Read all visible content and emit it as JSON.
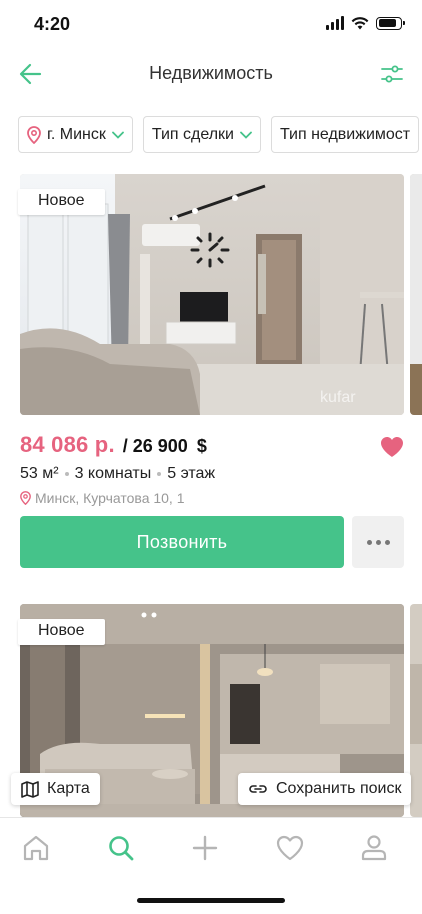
{
  "status": {
    "time": "4:20",
    "battery_level": 0.85
  },
  "header": {
    "title": "Недвижимость",
    "back_icon": "arrow-left-icon",
    "filter_icon": "sliders-icon",
    "accent": "#45c38a"
  },
  "filters": {
    "city": "г. Минск",
    "deal_type": "Тип сделки",
    "property_type": "Тип недвижимост"
  },
  "listing1": {
    "badge": "Новое",
    "price": "84 086 р.",
    "price_usd": "/ 26 900",
    "currency": "$",
    "area": "53 м²",
    "rooms": "3 комнаты",
    "floor": "5 этаж",
    "address": "Минск, Курчатова 10, 1",
    "call_label": "Позвонить",
    "favorite": true,
    "price_color": "#e6637f",
    "watermark": "kufar"
  },
  "listing2": {
    "badge": "Новое"
  },
  "floating": {
    "map_label": "Карта",
    "save_search_label": "Сохранить поиск"
  },
  "tabs": [
    "home-icon",
    "search-icon",
    "plus-icon",
    "heart-icon",
    "profile-icon"
  ],
  "active_tab": "search-icon"
}
